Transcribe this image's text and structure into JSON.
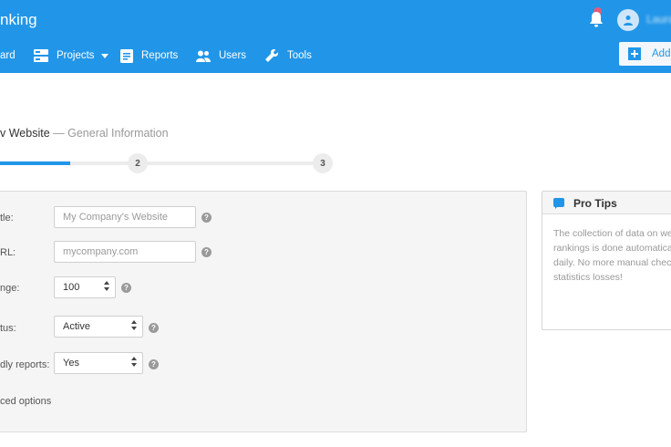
{
  "header": {
    "brand": "nking",
    "username": "Laura",
    "nav": [
      {
        "label": "ard",
        "icon": "dashboard-icon"
      },
      {
        "label": "Projects",
        "icon": "projects-icon",
        "has_dropdown": true
      },
      {
        "label": "Reports",
        "icon": "reports-icon"
      },
      {
        "label": "Users",
        "icon": "users-icon"
      },
      {
        "label": "Tools",
        "icon": "tools-icon"
      }
    ],
    "add_button": "Add"
  },
  "wizard": {
    "title": "v Website",
    "subtitle": "— General Information",
    "steps": [
      "2",
      "3"
    ],
    "progress": 0.21
  },
  "form": {
    "fields": [
      {
        "label": "tle:",
        "placeholder": "My Company's Website",
        "type": "text"
      },
      {
        "label": "RL:",
        "placeholder": "mycompany.com",
        "type": "text"
      },
      {
        "label": "nge:",
        "value": "100",
        "type": "number"
      },
      {
        "label": "tus:",
        "value": "Active",
        "type": "select"
      },
      {
        "label": "dly reports:",
        "value": "Yes",
        "type": "select"
      }
    ],
    "advanced": "ced options"
  },
  "tips": {
    "title": "Pro Tips",
    "lines": [
      "The collection of data on we",
      "rankings is done automatica",
      "daily. No more manual chec",
      "statistics losses!"
    ]
  },
  "colors": {
    "primary": "#2196e8",
    "panel": "#f5f5f5",
    "badge": "#e45a7c"
  }
}
